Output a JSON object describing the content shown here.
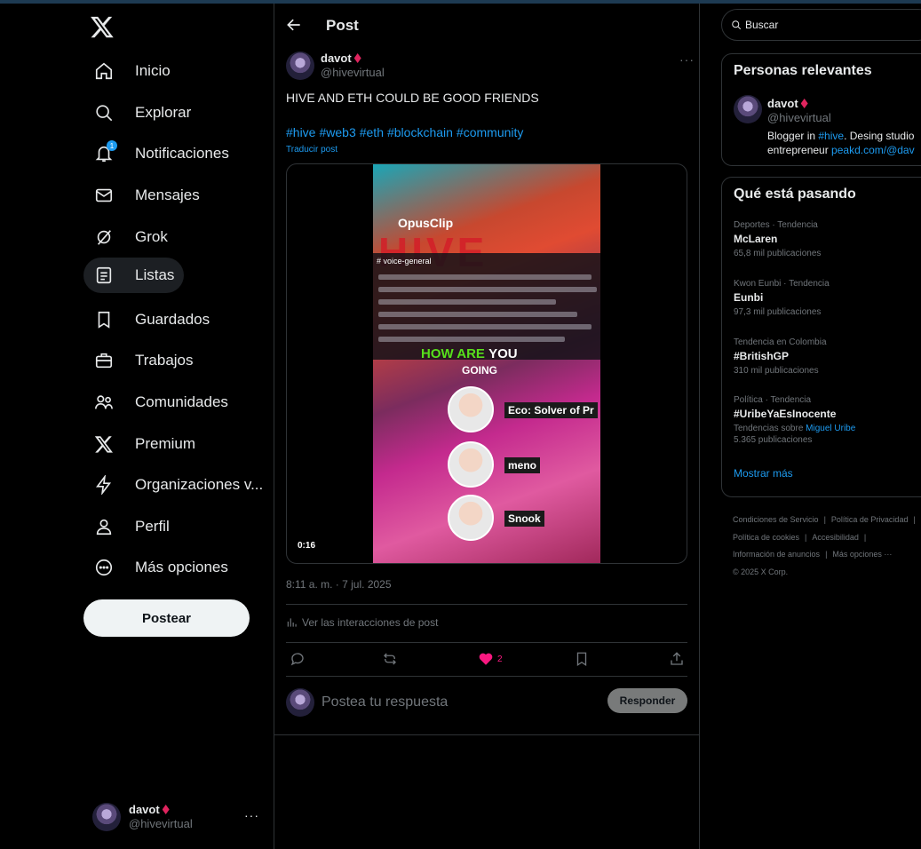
{
  "nav": {
    "items": [
      {
        "label": "Inicio",
        "icon": "home-icon"
      },
      {
        "label": "Explorar",
        "icon": "search-icon"
      },
      {
        "label": "Notificaciones",
        "icon": "bell-icon",
        "badge": "1"
      },
      {
        "label": "Mensajes",
        "icon": "envelope-icon"
      },
      {
        "label": "Grok",
        "icon": "grok-icon"
      },
      {
        "label": "Listas",
        "icon": "list-icon"
      },
      {
        "label": "Guardados",
        "icon": "bookmark-icon"
      },
      {
        "label": "Trabajos",
        "icon": "briefcase-icon"
      },
      {
        "label": "Comunidades",
        "icon": "people-icon"
      },
      {
        "label": "Premium",
        "icon": "x-logo-icon"
      },
      {
        "label": "Organizaciones v...",
        "icon": "lightning-icon"
      },
      {
        "label": "Perfil",
        "icon": "person-icon"
      },
      {
        "label": "Más opciones",
        "icon": "more-circle-icon"
      }
    ],
    "post_button": "Postear",
    "account": {
      "name": "davot",
      "handle": "@hivevirtual",
      "more": "···"
    }
  },
  "main": {
    "title": "Post",
    "author": {
      "name": "davot",
      "handle": "@hivevirtual"
    },
    "text": "HIVE AND ETH COULD BE GOOD FRIENDS",
    "hashtags": [
      "#hive",
      "#web3",
      "#eth",
      "#blockchain",
      "#community"
    ],
    "translate": "Traducir post",
    "video": {
      "duration": "0:16",
      "brand": "OpusClip",
      "overlay_big": "HIVE",
      "channel": "# voice-general",
      "how_are": "HOW ARE",
      "you": "YOU",
      "going": "GOING",
      "speakers": [
        "Eco: Solver of Pr",
        "meno",
        "Snook"
      ]
    },
    "timestamp": "8:11 a. m. · 7 jul. 2025",
    "interactions": "Ver las interacciones de post",
    "like_count": "2",
    "reply_placeholder": "Postea tu respuesta",
    "reply_button": "Responder"
  },
  "right": {
    "search_placeholder": "Buscar",
    "relevant": {
      "title": "Personas relevantes",
      "name": "davot",
      "handle": "@hivevirtual",
      "bio_prefix": "Blogger in ",
      "bio_link": "#hive",
      "bio_mid": ". Desing studio",
      "bio_line2": "entrepreneur ",
      "bio_link2": "peakd.com/@dav"
    },
    "trending": {
      "title": "Qué está pasando",
      "items": [
        {
          "context": "Deportes · Tendencia",
          "title": "McLaren",
          "count": "65,8 mil publicaciones"
        },
        {
          "context": "Kwon Eunbi · Tendencia",
          "title": "Eunbi",
          "count": "97,3 mil publicaciones"
        },
        {
          "context": "Tendencia en Colombia",
          "title": "#BritishGP",
          "count": "310 mil publicaciones"
        },
        {
          "context": "Política · Tendencia",
          "title": "#UribeYaEsInocente",
          "about_prefix": "Tendencias sobre ",
          "about_link": "Miguel Uribe",
          "count": "5.365 publicaciones"
        }
      ],
      "show_more": "Mostrar más"
    },
    "footer": [
      "Condiciones de Servicio",
      "|",
      "Política de Privacidad",
      "|",
      "Política de cookies",
      "|",
      "Accesibilidad",
      "|",
      "Información de anuncios",
      "|",
      "Más opciones ···",
      "© 2025 X Corp."
    ]
  },
  "colors": {
    "accent": "#1d9bf0",
    "like": "#f91880",
    "bg": "#000000",
    "border": "#2f3336"
  }
}
